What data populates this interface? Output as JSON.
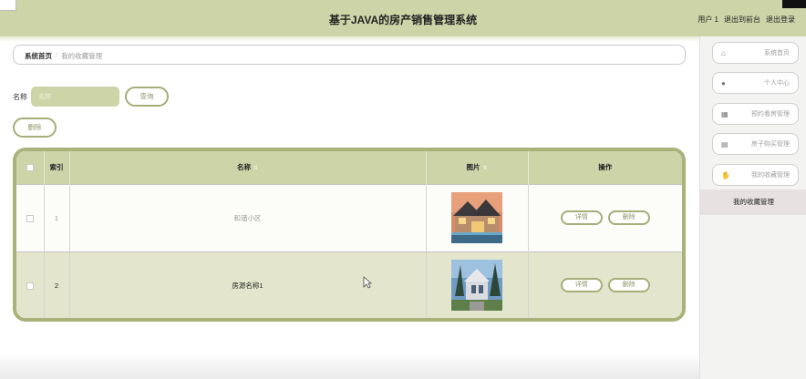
{
  "header": {
    "title": "基于JAVA的房产销售管理系统",
    "user": "用户 1",
    "front_link": "退出到前台",
    "logout_link": "退出登录"
  },
  "breadcrumb": {
    "home": "系统首页",
    "separator": "/",
    "current": "我的收藏管理"
  },
  "search": {
    "label": "名称",
    "placeholder": "名称",
    "query_button": "查询"
  },
  "toolbar": {
    "delete_button": "删除"
  },
  "table": {
    "columns": [
      "索引",
      "名称",
      "图片",
      "操作"
    ],
    "rows": [
      {
        "index": "1",
        "name": "和谐小区",
        "detail": "详情",
        "delete": "删除"
      },
      {
        "index": "2",
        "name": "房源名称1",
        "detail": "详情",
        "delete": "删除"
      }
    ]
  },
  "sidebar": {
    "items": [
      {
        "icon": "home-icon",
        "label": "系统首页"
      },
      {
        "icon": "user-icon",
        "label": "个人中心"
      },
      {
        "icon": "calendar-icon",
        "label": "预约看房管理"
      },
      {
        "icon": "document-icon",
        "label": "房子购买管理"
      },
      {
        "icon": "thumb-icon",
        "label": "我的收藏管理"
      }
    ],
    "active_label": "我的收藏管理"
  },
  "colors": {
    "header_bg": "#cdd4a8",
    "accent_border": "#a9b27b",
    "row_alt": "#e3e6cc"
  }
}
